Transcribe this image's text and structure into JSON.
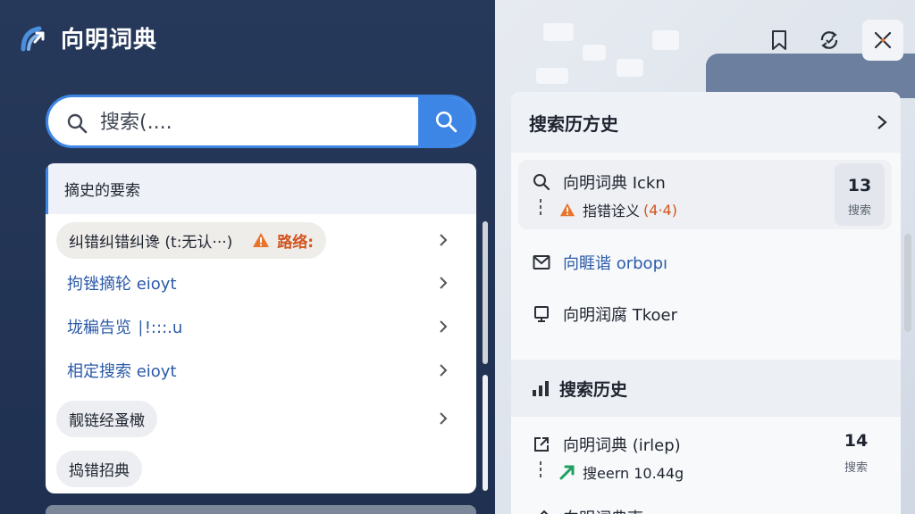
{
  "app": {
    "title": "向明词典"
  },
  "search": {
    "placeholder": "搜索(...."
  },
  "suggestions": {
    "header": "摘史的要索",
    "items": [
      {
        "label": "纠错纠错纠谗 (t:无认···)",
        "warning": "路络:"
      },
      {
        "label": "拘锉摘轮 eioyt"
      },
      {
        "label": "垅稨告览 ∣!:::.u"
      },
      {
        "label": "相定搜索 eioyt"
      },
      {
        "label": "靓链经蚤橄"
      },
      {
        "label": "捣错招典"
      }
    ]
  },
  "history": {
    "header": "搜索历方史",
    "items": [
      {
        "title": "向明词典 Ickn",
        "sub": "指错诠义",
        "sub_badge": "(4·4)",
        "count": "13",
        "count_label": "搜索"
      },
      {
        "title": "向睚谐 orbopı"
      },
      {
        "title": "向明润腐 Tkoer"
      }
    ],
    "section_title": "搜索历史",
    "section_items": [
      {
        "title": "向明词典 (irlep)",
        "sub": "搜eern 10.44g",
        "count": "14",
        "count_label": "搜索"
      },
      {
        "title": "向明词典夷"
      }
    ]
  },
  "colors": {
    "accent": "#3d86e6",
    "panel_dark": "#25375a",
    "warning": "#e8742b",
    "trend": "#20a060"
  }
}
